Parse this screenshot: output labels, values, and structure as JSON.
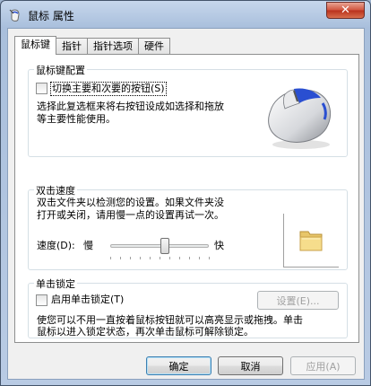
{
  "window": {
    "title": "鼠标 属性",
    "close_glyph": "✕"
  },
  "tabs": [
    {
      "label": "鼠标键"
    },
    {
      "label": "指针"
    },
    {
      "label": "指针选项"
    },
    {
      "label": "硬件"
    }
  ],
  "button_config": {
    "title": "鼠标键配置",
    "swap_label": "切换主要和次要的按钮(S)",
    "swap_checked": false,
    "description_line1": "选择此复选框来将右按钮设成如选择和拖放",
    "description_line2": "等主要性能使用。"
  },
  "double_click": {
    "title": "双击速度",
    "description_line1": "双击文件夹以检测您的设置。如果文件夹没",
    "description_line2": "打开或关闭，请用慢一点的设置再试一次。",
    "speed_label": "速度(D):",
    "slow_label": "慢",
    "fast_label": "快",
    "speed_value": 0.55,
    "folder_icon": "folder-icon"
  },
  "click_lock": {
    "title": "单击锁定",
    "enable_label": "启用单击锁定(T)",
    "enable_checked": false,
    "settings_label": "设置(E)...",
    "description_line1": "使您可以不用一直按着鼠标按钮就可以高亮显示或拖拽。单击",
    "description_line2": "鼠标以进入锁定状态，再次单击鼠标可解除锁定。"
  },
  "footer": {
    "ok_label": "确定",
    "cancel_label": "取消",
    "apply_label": "应用(A)"
  },
  "colors": {
    "title_gradient_top": "#c7d7ec",
    "close_button": "#d0533c",
    "mouse_accent": "#2a4fd1"
  }
}
